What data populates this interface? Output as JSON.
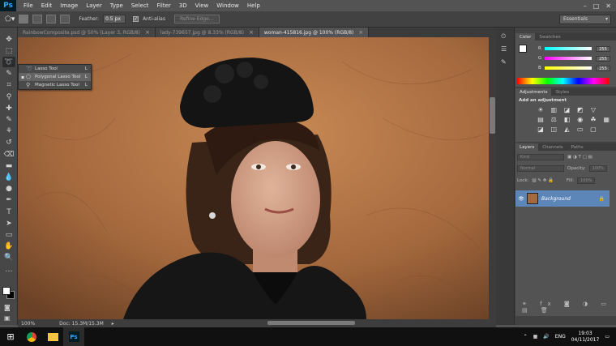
{
  "app": {
    "logo": "Ps"
  },
  "menu": [
    "File",
    "Edit",
    "Image",
    "Layer",
    "Type",
    "Select",
    "Filter",
    "3D",
    "View",
    "Window",
    "Help"
  ],
  "window_controls": {
    "minimize": "–",
    "maximize": "□",
    "close": "✕"
  },
  "options": {
    "feather_label": "Feather:",
    "feather_value": "0.5 px",
    "antialias_label": "Anti-alias",
    "antialias_checked": "✓",
    "refine_label": "Refine Edge...",
    "workspace": "Essentials"
  },
  "tabs": [
    {
      "label": "RainbowComposite.psd @ 50% (Layer 3, RGB/8)"
    },
    {
      "label": "lady-739657.jpg @ 8.33% (RGB/8)"
    },
    {
      "label": "woman-415816.jpg @ 100% (RGB/8)"
    }
  ],
  "tab_close": "×",
  "flyout": {
    "items": [
      {
        "label": "Lasso Tool",
        "key": "L",
        "icon": "lasso-icon"
      },
      {
        "label": "Polygonal Lasso Tool",
        "key": "L",
        "icon": "polygonal-lasso-icon",
        "bullet": "▪"
      },
      {
        "label": "Magnetic Lasso Tool",
        "key": "L",
        "icon": "magnetic-lasso-icon"
      }
    ]
  },
  "status": {
    "zoom": "100%",
    "doc": "Doc: 15.3M/15.3M"
  },
  "color_panel": {
    "tabs": [
      "Color",
      "Swatches"
    ],
    "channels": [
      {
        "name": "R",
        "value": "255",
        "color": "#e84a4a"
      },
      {
        "name": "G",
        "value": "255",
        "color": "#e04ad8"
      },
      {
        "name": "B",
        "value": "255",
        "color": "#f0e040"
      }
    ]
  },
  "adjustments_panel": {
    "tabs": [
      "Adjustments",
      "Styles"
    ],
    "heading": "Add an adjustment"
  },
  "layers_panel": {
    "tabs": [
      "Layers",
      "Channels",
      "Paths"
    ],
    "kind": "Kind",
    "blend": "Normal",
    "opacity_label": "Opacity:",
    "opacity_value": "100%",
    "lock_label": "Lock:",
    "fill_label": "Fill:",
    "fill_value": "100%",
    "layer_name": "Background"
  },
  "taskbar": {
    "lang": "ENG",
    "time": "19:03",
    "date": "04/11/2017"
  }
}
